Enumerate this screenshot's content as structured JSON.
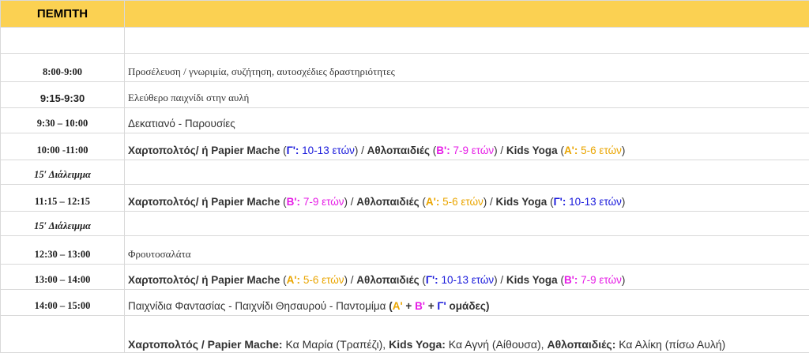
{
  "day": "ΠΕΜΠΤΗ",
  "colors": {
    "header_bg": "#fbd152",
    "group_g": "#1a1adb",
    "group_b": "#e61de6",
    "group_a": "#eaa500"
  },
  "rows": [
    {
      "time": "8:00-9:00",
      "text": "Προσέλευση / γνωριμία, συζήτηση, αυτοσχέδιες δραστηριότητες"
    },
    {
      "time": "9:15-9:30",
      "text": "Ελεύθερο παιχνίδι στην αυλή"
    },
    {
      "time": "9:30 – 10:00",
      "text": "Δεκατιανό - Παρουσίες"
    },
    {
      "time": "10:00 -11:00",
      "papier": "Χαρτοπολτός/ ή Papier Mache",
      "papier_group": "Γ':",
      "papier_age": " 10-13 ετών",
      "ath": "Αθλοπαιδιές",
      "ath_group": "Β':",
      "ath_age": " 7-9 ετών",
      "yoga": "Kids Yoga",
      "yoga_group": "Α':",
      "yoga_age": " 5-6 ετών"
    },
    {
      "break": "15′ Διάλειμμα"
    },
    {
      "time": "11:15 – 12:15",
      "papier": "Χαρτοπολτός/ ή Papier Mache",
      "papier_group": "Β':",
      "papier_age": " 7-9  ετών",
      "ath": "Αθλοπαιδιές",
      "ath_group": "Α':",
      "ath_age": " 5-6 ετών",
      "yoga": "Kids Yoga",
      "yoga_group": "Γ':",
      "yoga_age": " 10-13 ετών"
    },
    {
      "break": "15′ Διάλειμμα"
    },
    {
      "time": "12:30 – 13:00",
      "text": "Φρουτοσαλάτα"
    },
    {
      "time": "13:00 – 14:00",
      "papier": "Χαρτοπολτός/ ή Papier Mache",
      "papier_group": "Α':",
      "papier_age": " 5-6  ετών",
      "ath": "Αθλοπαιδιές",
      "ath_group": "Γ':",
      "ath_age": " 10-13 ετών",
      "yoga": "Kids Yoga",
      "yoga_group": "Β':",
      "yoga_age": " 7-9 ετών"
    },
    {
      "time": "14:00 – 15:00",
      "text": "Παιχνίδια Φαντασίας - Παιχνίδι Θησαυρού - Παντομίμα",
      "groups": [
        "Α'",
        "Β'",
        "Γ'"
      ],
      "groups_suffix": "ομάδες"
    }
  ],
  "footer": {
    "papier_label": "Χαρτοπολτός / Papier Mache:",
    "papier_info": " Κα Μαρία (Τραπέζι),",
    "yoga_label": "Kids Yoga:",
    "yoga_info": " Κα Αγνή (Αίθουσα),",
    "ath_label": "Αθλοπαιδιές:",
    "ath_info": " Κα Αλίκη (πίσω Αυλή)"
  }
}
